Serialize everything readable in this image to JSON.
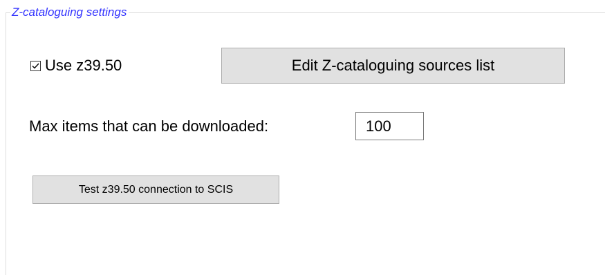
{
  "groupbox": {
    "title": "Z-cataloguing settings"
  },
  "use_z3950": {
    "label": "Use z39.50",
    "checked": true
  },
  "edit_sources_button": {
    "label": "Edit Z-cataloguing sources list"
  },
  "max_items": {
    "label": "Max items that can be downloaded:",
    "value": "100"
  },
  "test_connection_button": {
    "label": "Test z39.50 connection to SCIS"
  },
  "colors": {
    "group_title": "#3333ff",
    "button_face": "#e1e1e1",
    "button_border": "#adadad",
    "group_border": "#dcdcdc"
  },
  "icons": {
    "checkbox_check": "check-icon"
  }
}
